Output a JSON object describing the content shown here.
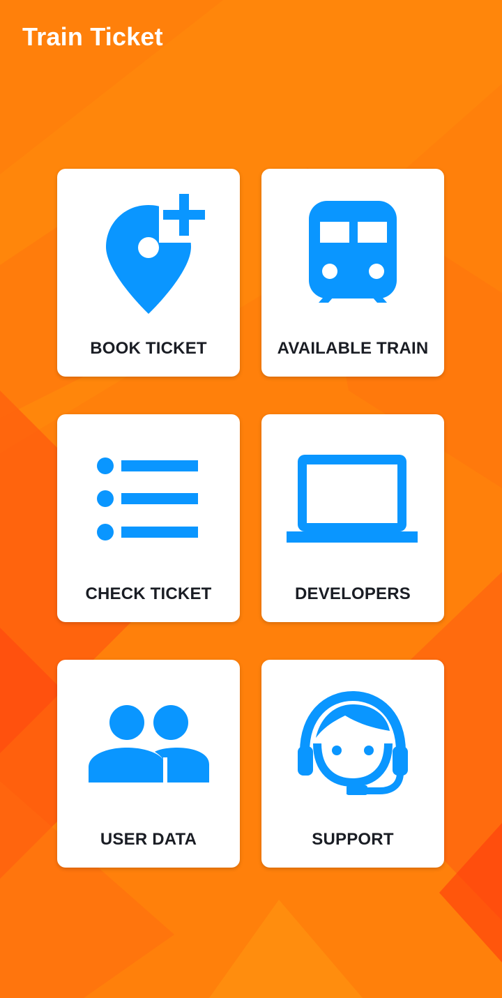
{
  "app": {
    "title": "Train Ticket"
  },
  "colors": {
    "background": "#ff7f0a",
    "background_shade": "#ff5a12",
    "accent": "#0a96ff",
    "tile": "#ffffff",
    "label": "#1a1d24"
  },
  "menu": {
    "items": [
      {
        "label": "BOOK TICKET",
        "icon": "add-location-icon"
      },
      {
        "label": "AVAILABLE TRAIN",
        "icon": "train-icon"
      },
      {
        "label": "CHECK TICKET",
        "icon": "list-icon"
      },
      {
        "label": "DEVELOPERS",
        "icon": "laptop-icon"
      },
      {
        "label": "USER DATA",
        "icon": "people-icon"
      },
      {
        "label": "SUPPORT",
        "icon": "support-agent-icon"
      }
    ]
  }
}
